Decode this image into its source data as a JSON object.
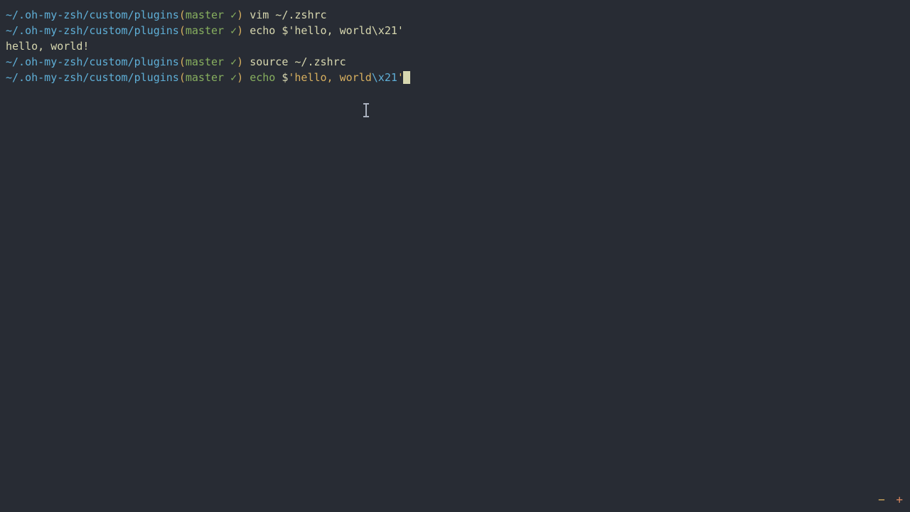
{
  "prompt": {
    "path": "~/.oh-my-zsh/custom/plugins",
    "paren_open": "(",
    "branch": "master",
    "check": " ✓",
    "paren_close": ")"
  },
  "lines": [
    {
      "cmd_plain": "vim ~/.zshrc"
    },
    {
      "cmd_plain": "echo $'hello, world\\x21'"
    }
  ],
  "output1": "hello, world!",
  "line3_cmd": "source ~/.zshrc",
  "current": {
    "builtin": "echo",
    "dollar": " $",
    "str_open": "'",
    "str_body": "hello, world",
    "escape": "\\x21",
    "str_close": "'"
  },
  "controls": {
    "minus": "−",
    "plus": "+"
  }
}
